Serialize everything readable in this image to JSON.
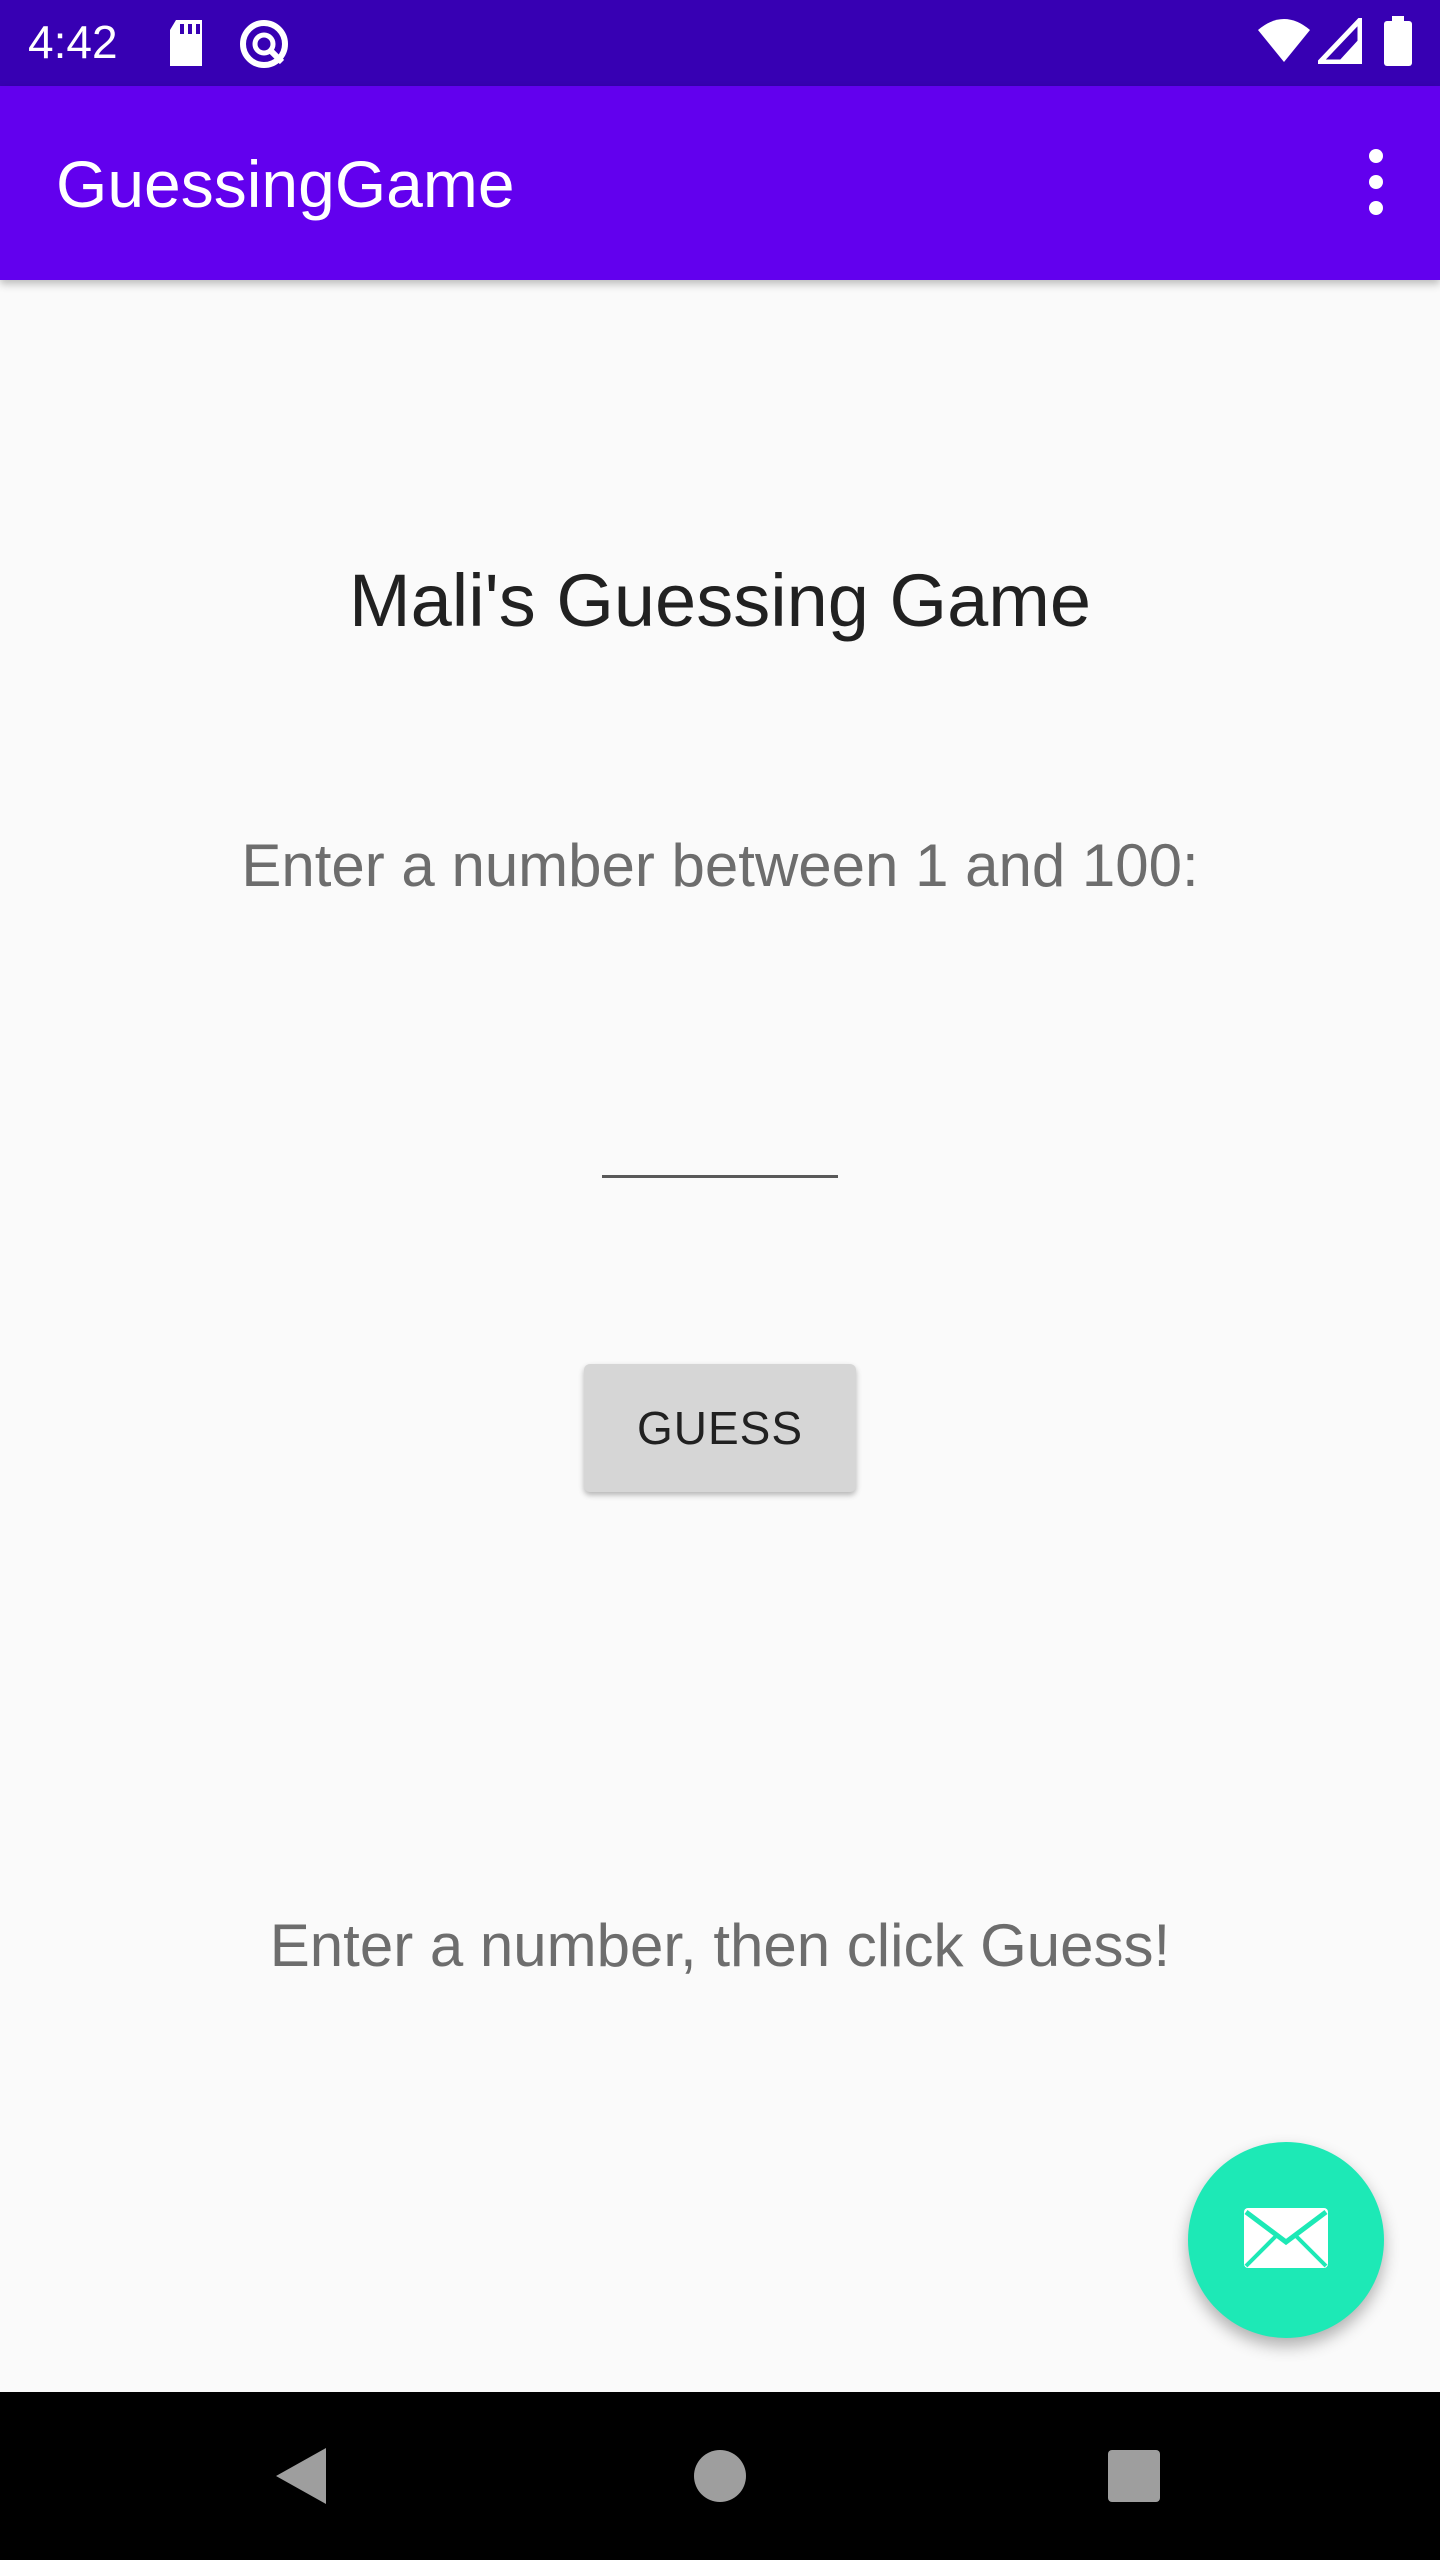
{
  "status_bar": {
    "time": "4:42",
    "icons": [
      "sd-card-icon",
      "accessibility-icon",
      "wifi-icon",
      "signal-icon",
      "battery-icon"
    ]
  },
  "app_bar": {
    "title": "GuessingGame",
    "menu_icon": "more-vert-icon"
  },
  "main": {
    "heading": "Mali's Guessing Game",
    "prompt": "Enter a number between 1 and 100:",
    "input_value": "",
    "guess_button_label": "GUESS",
    "result_text": "Enter a number, then click Guess!"
  },
  "fab": {
    "icon": "email-icon"
  },
  "nav_bar": {
    "buttons": [
      "back-icon",
      "home-icon",
      "recents-icon"
    ]
  },
  "colors": {
    "status_bar": "#3700b3",
    "app_bar": "#6200ee",
    "fab": "#1de9b6",
    "background": "#fafafa"
  }
}
